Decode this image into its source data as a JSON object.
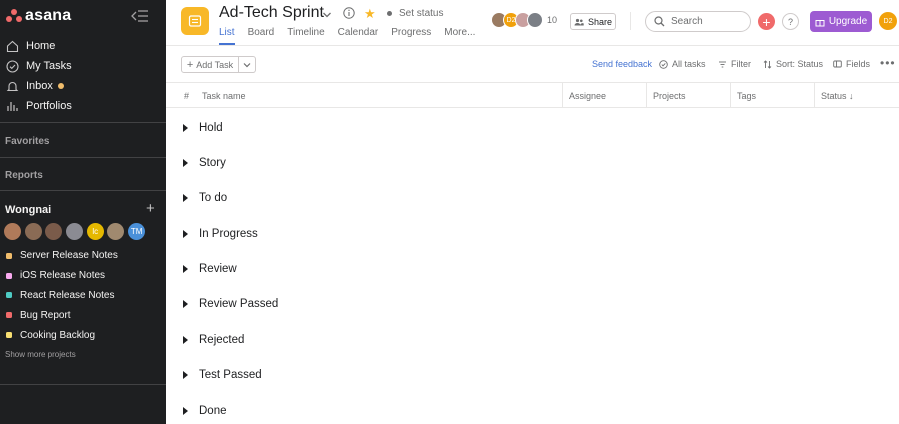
{
  "sidebar": {
    "logo": "asana",
    "nav": [
      {
        "label": "Home",
        "icon": "home-icon"
      },
      {
        "label": "My Tasks",
        "icon": "check-circle-icon"
      },
      {
        "label": "Inbox",
        "icon": "bell-icon",
        "has_unread": true
      },
      {
        "label": "Portfolios",
        "icon": "bar-chart-icon"
      }
    ],
    "favorites_title": "Favorites",
    "reports_title": "Reports",
    "team": {
      "name": "Wongnai",
      "avatars": [
        {
          "initials": "",
          "color": "#b07a5a"
        },
        {
          "initials": "",
          "color": "#8a6b55"
        },
        {
          "initials": "",
          "color": "#7a5b4a"
        },
        {
          "initials": "",
          "color": "#8b8b93"
        },
        {
          "initials": "lc",
          "color": "#e5b800"
        },
        {
          "initials": "",
          "color": "#a0896f"
        },
        {
          "initials": "TM",
          "color": "#4a90d9"
        }
      ]
    },
    "projects": [
      {
        "label": "Server Release Notes",
        "color": "#f1bd6c"
      },
      {
        "label": "iOS Release Notes",
        "color": "#f9aaef"
      },
      {
        "label": "React Release Notes",
        "color": "#4ecbc4"
      },
      {
        "label": "Bug Report",
        "color": "#f06a6a"
      },
      {
        "label": "Cooking Backlog",
        "color": "#f8df72"
      }
    ],
    "show_more": "Show more projects"
  },
  "header": {
    "title": "Ad-Tech Sprint",
    "set_status": "Set status",
    "tabs": [
      "List",
      "Board",
      "Timeline",
      "Calendar",
      "Progress",
      "More..."
    ],
    "active_tab": "List",
    "member_avatars": [
      {
        "initials": "",
        "color": "#9a7b62"
      },
      {
        "initials": "D2",
        "color": "#f1a10b"
      },
      {
        "initials": "",
        "color": "#c9a0a0"
      },
      {
        "initials": "",
        "color": "#7b7f86"
      }
    ],
    "member_count": "10",
    "share_label": "Share",
    "search_placeholder": "Search",
    "help_label": "?",
    "upgrade_label": "Upgrade",
    "user_initials": "D2"
  },
  "toolbar": {
    "add_task": "Add Task",
    "send_feedback": "Send feedback",
    "all_tasks": "All tasks",
    "filter": "Filter",
    "sort": "Sort: Status",
    "fields": "Fields"
  },
  "table": {
    "hash": "#",
    "columns": [
      "Task name",
      "Assignee",
      "Projects",
      "Tags",
      "Status"
    ],
    "sort_indicator": "↓",
    "sections": [
      "Hold",
      "Story",
      "To do",
      "In Progress",
      "Review",
      "Review Passed",
      "Rejected",
      "Test Passed",
      "Done"
    ]
  },
  "colors": {
    "sidebar_bg": "#1e1f21",
    "accent_blue": "#4573d2",
    "project_icon": "#f8b828",
    "upgrade": "#9d5bd2",
    "add_button": "#f06a6a"
  }
}
